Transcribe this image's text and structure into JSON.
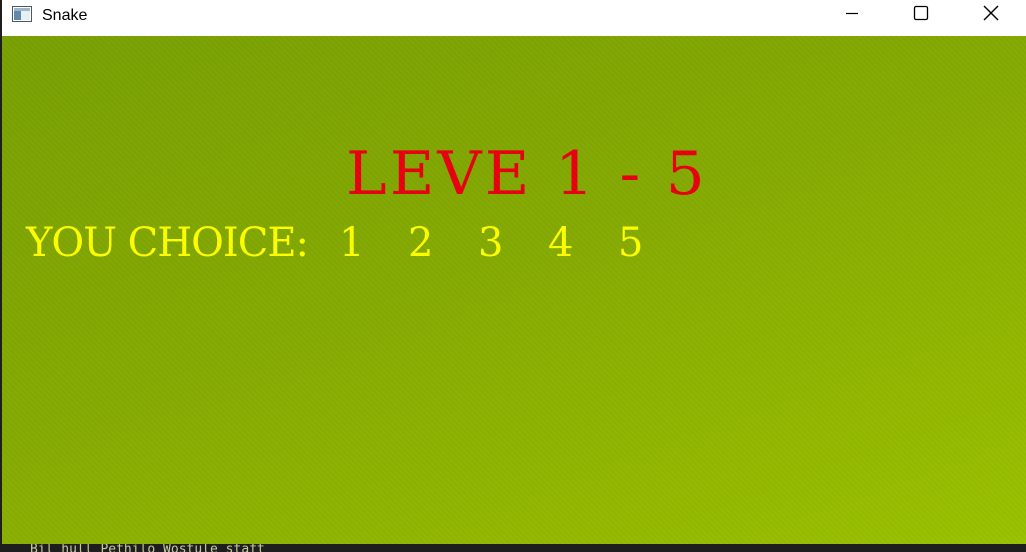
{
  "window": {
    "title": "Snake",
    "icon": "app-window-icon"
  },
  "controls": {
    "minimize_icon": "minimize-icon",
    "maximize_icon": "maximize-icon",
    "close_icon": "close-icon"
  },
  "game": {
    "level_title": "LEVE 1 - 5",
    "choice_label": "YOU CHOICE:",
    "options": [
      "1",
      "2",
      "3",
      "4",
      "5"
    ],
    "colors": {
      "title": "#e8000e",
      "choice_text": "#ffff00",
      "background": "#85aa02"
    }
  },
  "console": {
    "partial_text": "Bil hull     Pethilo Wostule staft"
  }
}
